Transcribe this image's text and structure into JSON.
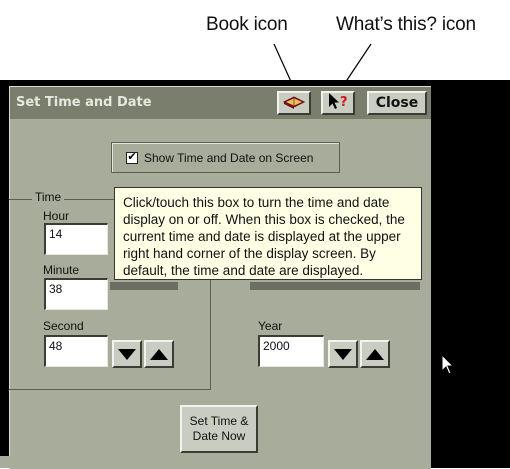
{
  "callouts": {
    "book_icon": "Book icon",
    "whats_this_icon": "What’s this? icon"
  },
  "window": {
    "title": "Set Time and Date",
    "close_label": "Close"
  },
  "show_checkbox": {
    "label": "Show Time and Date on Screen",
    "checked": true
  },
  "time_group": {
    "title": "Time",
    "hour_label": "Hour",
    "hour_value": "14",
    "minute_label": "Minute",
    "minute_value": "38",
    "second_label": "Second",
    "second_value": "48"
  },
  "date_group": {
    "year_label": "Year",
    "year_value": "2000"
  },
  "tooltip": {
    "text": "Click/touch this box to turn the time and date display on or off. When this box is checked, the current time and date is displayed at the upper right hand corner of the display screen. By default, the time and date are displayed."
  },
  "set_button": {
    "label": "Set Time & Date Now"
  },
  "icons": {
    "book": "book-icon",
    "help": "whats-this-icon",
    "cursor": "mouse-cursor-icon"
  },
  "colors": {
    "window_bg": "#a8ac9a",
    "titlebar_bg": "#7a7e6d",
    "tooltip_bg": "#ffffe6"
  }
}
